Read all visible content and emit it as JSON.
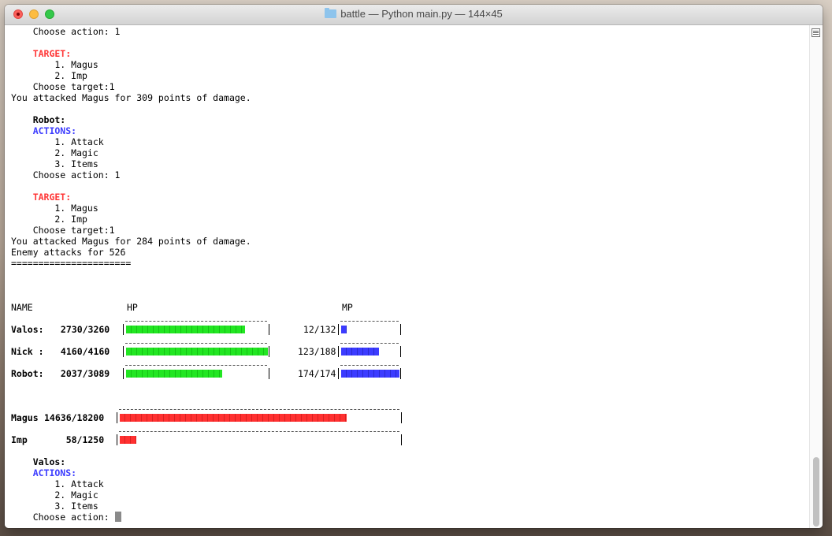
{
  "window": {
    "title": "battle — Python main.py — 144×45"
  },
  "terminal": {
    "log": [
      {
        "text": "    Choose action: 1",
        "style": ""
      },
      {
        "text": "",
        "style": ""
      },
      {
        "text": "    TARGET:",
        "style": "red"
      },
      {
        "text": "        1. Magus",
        "style": ""
      },
      {
        "text": "        2. Imp",
        "style": ""
      },
      {
        "text": "    Choose target:1",
        "style": ""
      },
      {
        "text": "You attacked Magus for 309 points of damage.",
        "style": ""
      },
      {
        "text": "",
        "style": ""
      },
      {
        "text": "    Robot:",
        "style": "b"
      },
      {
        "text": "    ACTIONS:",
        "style": "blue"
      },
      {
        "text": "        1. Attack",
        "style": ""
      },
      {
        "text": "        2. Magic",
        "style": ""
      },
      {
        "text": "        3. Items",
        "style": ""
      },
      {
        "text": "    Choose action: 1",
        "style": ""
      },
      {
        "text": "",
        "style": ""
      },
      {
        "text": "    TARGET:",
        "style": "red"
      },
      {
        "text": "        1. Magus",
        "style": ""
      },
      {
        "text": "        2. Imp",
        "style": ""
      },
      {
        "text": "    Choose target:1",
        "style": ""
      },
      {
        "text": "You attacked Magus for 284 points of damage.",
        "style": ""
      },
      {
        "text": "Enemy attacks for 526",
        "style": ""
      },
      {
        "text": "======================",
        "style": ""
      }
    ],
    "header": {
      "name": "NAME",
      "hp": "HP",
      "mp": "MP"
    },
    "players": [
      {
        "name": "Valos:",
        "hp_text": "2730/3260",
        "hp_fraction": 0.84,
        "mp_text": "12/132",
        "mp_fraction": 0.09
      },
      {
        "name": "Nick :",
        "hp_text": "4160/4160",
        "hp_fraction": 1.0,
        "mp_text": "123/188",
        "mp_fraction": 0.65
      },
      {
        "name": "Robot:",
        "hp_text": "2037/3089",
        "hp_fraction": 0.68,
        "mp_text": "174/174",
        "mp_fraction": 1.0
      }
    ],
    "enemies": [
      {
        "name": "Magus",
        "hp_text": "14636/18200",
        "hp_fraction": 0.81
      },
      {
        "name": "Imp",
        "hp_text": "58/1250",
        "hp_fraction": 0.06
      }
    ],
    "prompt": {
      "name": "    Valos:",
      "actions_label": "    ACTIONS:",
      "actions": [
        "        1. Attack",
        "        2. Magic",
        "        3. Items"
      ],
      "input_label": "    Choose action: "
    },
    "colors": {
      "hp_bar": "#22e622",
      "mp_bar": "#3c3cff",
      "enemy_bar": "#ff3030",
      "target_label": "#ff3636",
      "actions_label": "#3c3cff"
    }
  }
}
